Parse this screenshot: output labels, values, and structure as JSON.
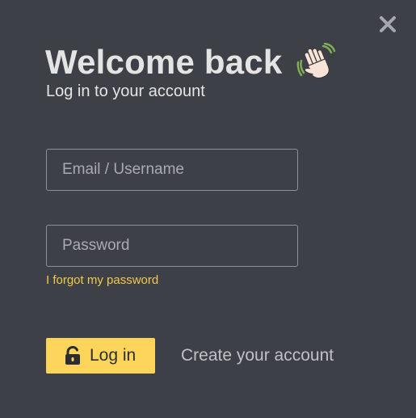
{
  "modal": {
    "title": "Welcome back",
    "subtitle": "Log in to your account",
    "title_icon": "waving-hand-icon",
    "close_icon": "close-icon"
  },
  "form": {
    "email_placeholder": "Email / Username",
    "email_value": "",
    "password_placeholder": "Password",
    "password_value": "",
    "forgot_label": "I forgot my password",
    "login_label": "Log in",
    "login_icon": "unlock-icon",
    "create_account_label": "Create your account"
  },
  "colors": {
    "background": "#3d4047",
    "accent": "#fdd55a",
    "link": "#f4c84a",
    "text": "#e4e4e4"
  }
}
